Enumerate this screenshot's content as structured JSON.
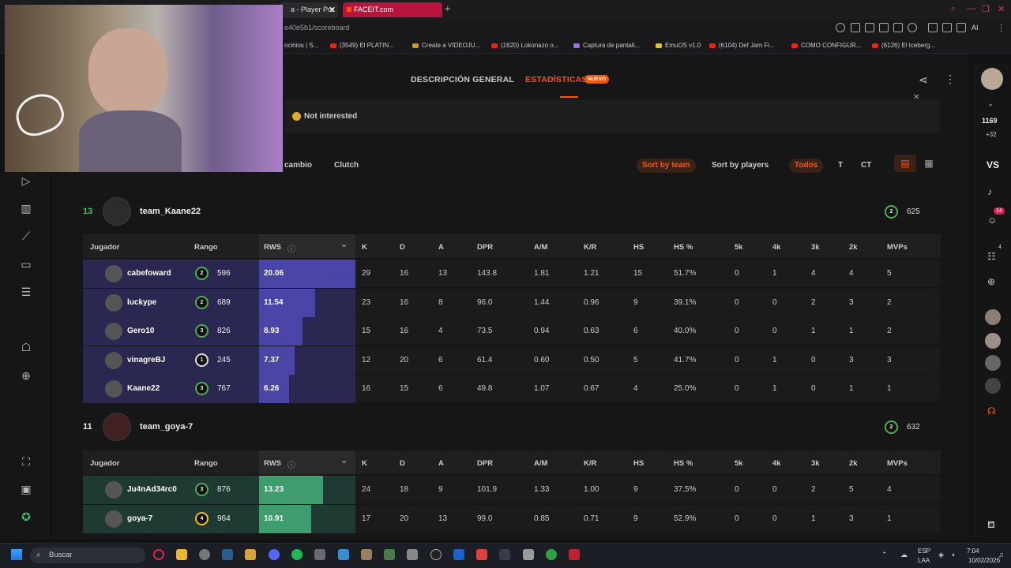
{
  "browser": {
    "tab1_title": "a - Player Pro",
    "tab2_title": "FACEIT.com",
    "url": "e40e5b1/scoreboard",
    "bookmarks": [
      "ocinios | S...",
      "(3549) El PLATIN...",
      "Create a VIDEOJU...",
      "(1620) Lokonazo o...",
      "Captura de pantall...",
      "EmuOS v1.0",
      "(6104) Def Jam Fi...",
      "COMO CONFIGUR...",
      "(6126) El Iceberg..."
    ],
    "ai_label": "AI"
  },
  "subnav": {
    "overview": "DESCRIPCIÓN GENERAL",
    "stats": "ESTADÍSTICAS",
    "badge": "NUEVO"
  },
  "banner": {
    "not_interested": "Not interested"
  },
  "filters": {
    "cambio": "cambio",
    "clutch": "Clutch",
    "sort_team": "Sort by team",
    "sort_players": "Sort by players",
    "todos": "Todos",
    "t": "T",
    "ct": "CT"
  },
  "headers": {
    "player": "Jugador",
    "rank": "Rango",
    "rws": "RWS",
    "cols": [
      "K",
      "D",
      "A",
      "DPR",
      "A/M",
      "K/R",
      "HS",
      "HS %",
      "5k",
      "4k",
      "3k",
      "2k",
      "MVPs"
    ]
  },
  "team1": {
    "score": "13",
    "name": "team_Kaane22",
    "level": "2",
    "elo": "625",
    "players": [
      {
        "name": "cabefoward",
        "level": "2",
        "elo": "596",
        "rws": "20.06",
        "rws_frac": 1.0,
        "stats": [
          "29",
          "16",
          "13",
          "143.8",
          "1.81",
          "1.21",
          "15",
          "51.7%",
          "0",
          "1",
          "4",
          "4",
          "5"
        ]
      },
      {
        "name": "luckype",
        "level": "2",
        "elo": "689",
        "rws": "11.54",
        "rws_frac": 0.58,
        "stats": [
          "23",
          "16",
          "8",
          "96.0",
          "1.44",
          "0.96",
          "9",
          "39.1%",
          "0",
          "0",
          "2",
          "3",
          "2"
        ]
      },
      {
        "name": "Gero10",
        "level": "3",
        "elo": "826",
        "rws": "8.93",
        "rws_frac": 0.45,
        "stats": [
          "15",
          "16",
          "4",
          "73.5",
          "0.94",
          "0.63",
          "6",
          "40.0%",
          "0",
          "0",
          "1",
          "1",
          "2"
        ]
      },
      {
        "name": "vinagreBJ",
        "level": "1",
        "elo": "245",
        "rws": "7.37",
        "rws_frac": 0.37,
        "stats": [
          "12",
          "20",
          "6",
          "61.4",
          "0.60",
          "0.50",
          "5",
          "41.7%",
          "0",
          "1",
          "0",
          "3",
          "3"
        ]
      },
      {
        "name": "Kaane22",
        "level": "3",
        "elo": "767",
        "rws": "6.26",
        "rws_frac": 0.31,
        "stats": [
          "16",
          "15",
          "6",
          "49.8",
          "1.07",
          "0.67",
          "4",
          "25.0%",
          "0",
          "1",
          "0",
          "1",
          "1"
        ]
      }
    ]
  },
  "team2": {
    "score": "11",
    "name": "team_goya-7",
    "level": "2",
    "elo": "632",
    "players": [
      {
        "name": "Ju4nAd34rc0",
        "level": "3",
        "elo": "876",
        "rws": "13.23",
        "rws_frac": 0.66,
        "stats": [
          "24",
          "18",
          "9",
          "101.9",
          "1.33",
          "1.00",
          "9",
          "37.5%",
          "0",
          "0",
          "2",
          "5",
          "4"
        ]
      },
      {
        "name": "goya-7",
        "level": "4",
        "elo": "964",
        "rws": "10.91",
        "rws_frac": 0.54,
        "stats": [
          "17",
          "20",
          "13",
          "99.0",
          "0.85",
          "0.71",
          "9",
          "52.9%",
          "0",
          "0",
          "1",
          "3",
          "1"
        ]
      }
    ]
  },
  "rsidebar": {
    "points": "1169",
    "delta": "+32",
    "vs": "VS",
    "badge1": "14",
    "badge2": "4"
  },
  "taskbar": {
    "search": "Buscar",
    "lang1": "ESP",
    "lang2": "LAA",
    "time": "7:04",
    "date": "10/02/2026"
  }
}
